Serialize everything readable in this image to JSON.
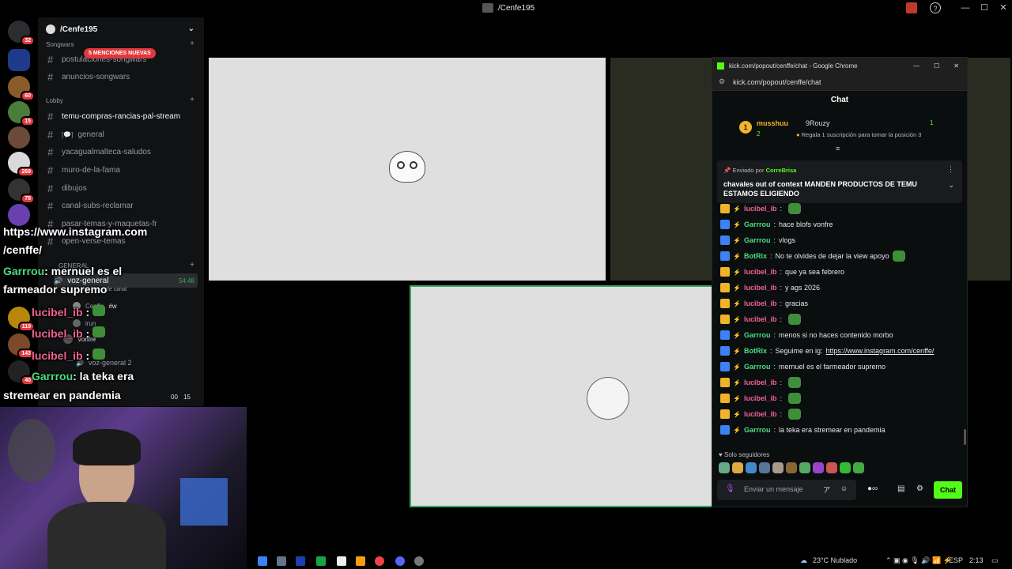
{
  "window": {
    "title": "/Cenfe195",
    "minimize": "—",
    "maximize": "☐",
    "close": "✕"
  },
  "rail": {
    "badges": [
      "32",
      "60",
      "15",
      "269",
      "78",
      "110",
      "143",
      "40"
    ]
  },
  "sidebar": {
    "server_name": "/Cenfe195",
    "mentions_pill": "5 MENCIONES NUEVAS",
    "categories": {
      "songwars": "Songwars",
      "lobby": "Lobby",
      "general": "GENERAL"
    },
    "channels": [
      "postulaciones-songwars",
      "anuncios-songwars",
      "temu-compras-rancias-pal-stream",
      "general",
      "yacagualmalteca-saludos",
      "muro-de-la-fama",
      "dibujos",
      "canal-subs-reclamar",
      "pasar-temas-y-maquetas-fr",
      "open-verse-temas"
    ],
    "voice": {
      "channel": "voz-general",
      "time": "54:48",
      "sub": "o de canal",
      "user1": "Cenffe",
      "user1_tag": "#w",
      "user2": "irun",
      "user3": "Vonfre",
      "channel2": "voz-general 2",
      "bottom_left": "00",
      "bottom_right": "15"
    }
  },
  "overlay": {
    "line1": "https://www.instagram.com",
    "line2": "/cenffe/",
    "msg1_user": "Garrrou",
    "msg1_text": ": mernuel es el",
    "msg1_text2": "farmeador supremo",
    "lucibel": "lucibel_ib",
    "colon": " :",
    "msg5_user": "Garrrou",
    "msg5_text": ": la teka era",
    "msg5_text2": "stremear en pandemia"
  },
  "chat": {
    "window_title": "kick.com/popout/cenffe/chat - Google Chrome",
    "url": "kick.com/popout/cenffe/chat",
    "header": "Chat",
    "leaderboard": {
      "rank": "1",
      "user1": "musshuu",
      "user1_count": "2",
      "user2": "9Rouzy",
      "user2_count": "1",
      "gift_text": "Regala 1 suscripción para tomar la posición 3"
    },
    "pinned": {
      "sent_by": "Enviado por",
      "sender": "CorreBrisa",
      "message": "chavales out of context MANDEN PRODUCTOS DE TEMU ESTAMOS ELIGIENDO"
    },
    "messages": [
      {
        "user": "lucibel_ib",
        "text": "",
        "color": "#f06292",
        "emote": true
      },
      {
        "user": "Garrrou",
        "text": "hace blofs vonfre",
        "color": "#4ade80",
        "emote": false
      },
      {
        "user": "Garrrou",
        "text": "vlogs",
        "color": "#4ade80",
        "emote": false
      },
      {
        "user": "BotRix",
        "text": "No te olvides de dejar la view apoyo",
        "color": "#4ade80",
        "emote": true
      },
      {
        "user": "lucibel_ib",
        "text": "que ya sea febrero",
        "color": "#f06292",
        "emote": false
      },
      {
        "user": "lucibel_ib",
        "text": "y ags 2026",
        "color": "#f06292",
        "emote": false
      },
      {
        "user": "lucibel_ib",
        "text": "gracias",
        "color": "#f06292",
        "emote": false
      },
      {
        "user": "lucibel_ib",
        "text": "",
        "color": "#f06292",
        "emote": true
      },
      {
        "user": "Garrrou",
        "text": "menos si no haces contenido morbo",
        "color": "#4ade80",
        "emote": false
      },
      {
        "user": "BotRix",
        "text": "Seguime en ig: ",
        "link": "https://www.instagram.com/cenffe/",
        "color": "#4ade80",
        "emote": false
      },
      {
        "user": "Garrrou",
        "text": "mernuel es el farmeador supremo",
        "color": "#4ade80",
        "emote": false
      },
      {
        "user": "lucibel_ib",
        "text": "",
        "color": "#f06292",
        "emote": true
      },
      {
        "user": "lucibel_ib",
        "text": "",
        "color": "#f06292",
        "emote": true
      },
      {
        "user": "lucibel_ib",
        "text": "",
        "color": "#f06292",
        "emote": true
      },
      {
        "user": "Garrrou",
        "text": "la teka era stremear en pandemia",
        "color": "#4ade80",
        "emote": false
      }
    ],
    "followers_only": "Solo seguidores",
    "input_placeholder": "Enviar un mensaje",
    "send_label": "Chat"
  },
  "taskbar": {
    "weather": "23°C  Nublado",
    "lang": "ESP",
    "time": "2:13"
  },
  "colors": {
    "kick_green": "#53fc18",
    "discord_red": "#e0383e"
  }
}
